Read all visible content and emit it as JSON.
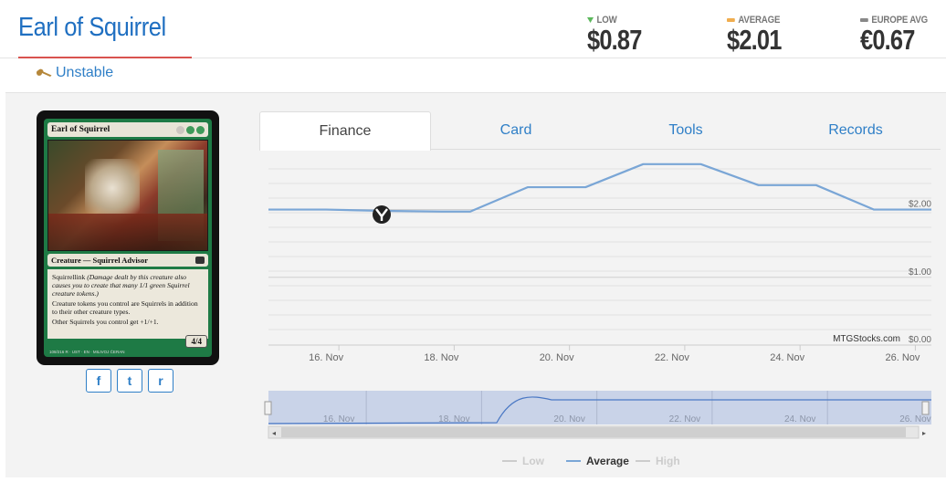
{
  "header": {
    "card_name": "Earl of Squirrel",
    "set_name": "Unstable",
    "prices": {
      "low_label": "LOW",
      "low_value": "$0.87",
      "average_label": "AVERAGE",
      "average_value": "$2.01",
      "europe_label": "EUROPE AVG",
      "europe_value": "€0.67"
    },
    "colors": {
      "low": "#5cb85c",
      "average": "#f0ad4e",
      "europe": "#888888",
      "accent": "#1f6fc1"
    }
  },
  "mtg_card": {
    "name": "Earl of Squirrel",
    "type_line": "Creature — Squirrel Advisor",
    "rules_1_keyword": "Squirrellink",
    "rules_1_reminder": "(Damage dealt by this creature also causes you to create that many 1/1 green Squirrel creature tokens.)",
    "rules_2": "Creature tokens you control are Squirrels in addition to their other creature types.",
    "rules_3": "Other Squirrels you control get +1/+1.",
    "pt": "4/4",
    "footer": "108/216 R · UST · EN · MILIVOJ ĆERAN"
  },
  "social": {
    "facebook": "f",
    "twitter": "t",
    "reddit": "r"
  },
  "tabs": [
    {
      "label": "Finance",
      "active": true
    },
    {
      "label": "Card",
      "active": false
    },
    {
      "label": "Tools",
      "active": false
    },
    {
      "label": "Records",
      "active": false
    }
  ],
  "chart_data": {
    "type": "line",
    "x_tick_labels": [
      "16. Nov",
      "18. Nov",
      "20. Nov",
      "22. Nov",
      "24. Nov",
      "26. Nov"
    ],
    "y_tick_labels": [
      "$2.00",
      "$1.00",
      "$0.00"
    ],
    "ylim": [
      0,
      2.6
    ],
    "credit": "MTGStocks.com",
    "series": [
      {
        "name": "Average",
        "color": "#7aa6d6",
        "x": [
          15.0,
          16.0,
          17.0,
          18.0,
          18.5,
          19.5,
          20.5,
          21.5,
          22.5,
          23.5,
          24.5,
          25.5,
          26.5
        ],
        "values": [
          2.0,
          2.0,
          1.98,
          1.97,
          1.97,
          2.33,
          2.33,
          2.67,
          2.67,
          2.36,
          2.36,
          2.0,
          2.0
        ]
      }
    ],
    "legend": [
      {
        "name": "Low",
        "enabled": false
      },
      {
        "name": "Average",
        "enabled": true
      },
      {
        "name": "High",
        "enabled": false
      }
    ],
    "navigator_labels": [
      "16. Nov",
      "18. Nov",
      "20. Nov",
      "22. Nov",
      "24. Nov",
      "26. Nov"
    ]
  }
}
